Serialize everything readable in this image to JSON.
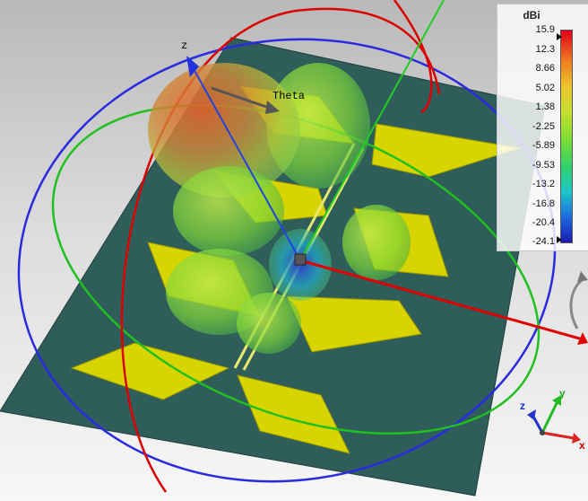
{
  "view": {
    "axis_label_z": "z",
    "theta_label": "Theta"
  },
  "legend": {
    "unit": "dBi",
    "ticks": [
      "15.9",
      "12.3",
      "8.66",
      "5.02",
      "1.38",
      "-2.25",
      "-5.89",
      "-9.53",
      "-13.2",
      "-16.8",
      "-20.4",
      "-24.1"
    ],
    "max": 15.9,
    "min": -24.1
  },
  "triad": {
    "x_label": "x",
    "y_label": "y",
    "z_label": "z"
  },
  "colors": {
    "background_top": "#b9b9b9",
    "substrate": "#2f5d5a",
    "patch": "#d8d400",
    "feed_line": "#e8e870",
    "x_axis": "#e00000",
    "y_axis": "#22cc22",
    "z_axis": "#2244dd",
    "theta_circle": "#dd0000",
    "phi_circle_blue": "#2a2ae0",
    "phi_circle_green": "#20c020"
  }
}
